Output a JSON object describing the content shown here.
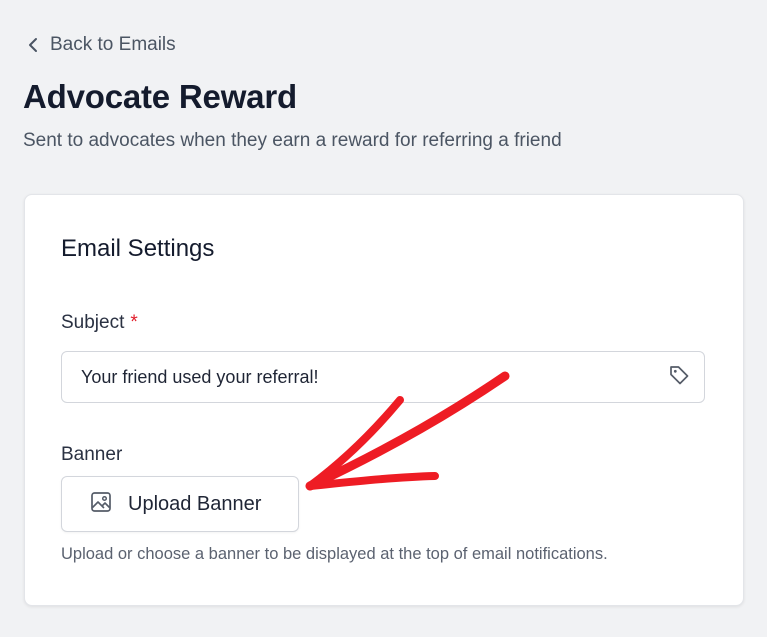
{
  "header": {
    "back_label": "Back to Emails",
    "title": "Advocate Reward",
    "subtitle": "Sent to advocates when they earn a reward for referring a friend"
  },
  "email_settings": {
    "title": "Email Settings",
    "subject": {
      "label": "Subject",
      "required_marker": "*",
      "value": "Your friend used your referral!",
      "icon": "tag-icon"
    },
    "banner": {
      "label": "Banner",
      "button_label": "Upload Banner",
      "button_icon": "image-icon",
      "help_text": "Upload or choose a banner to be displayed at the top of email notifications."
    }
  },
  "annotation": {
    "type": "hand-drawn arrow",
    "color": "#ee1c24",
    "points_to": "upload-banner-button"
  },
  "colors": {
    "background": "#f1f2f4",
    "card": "#ffffff",
    "required": "#e11d2a"
  }
}
